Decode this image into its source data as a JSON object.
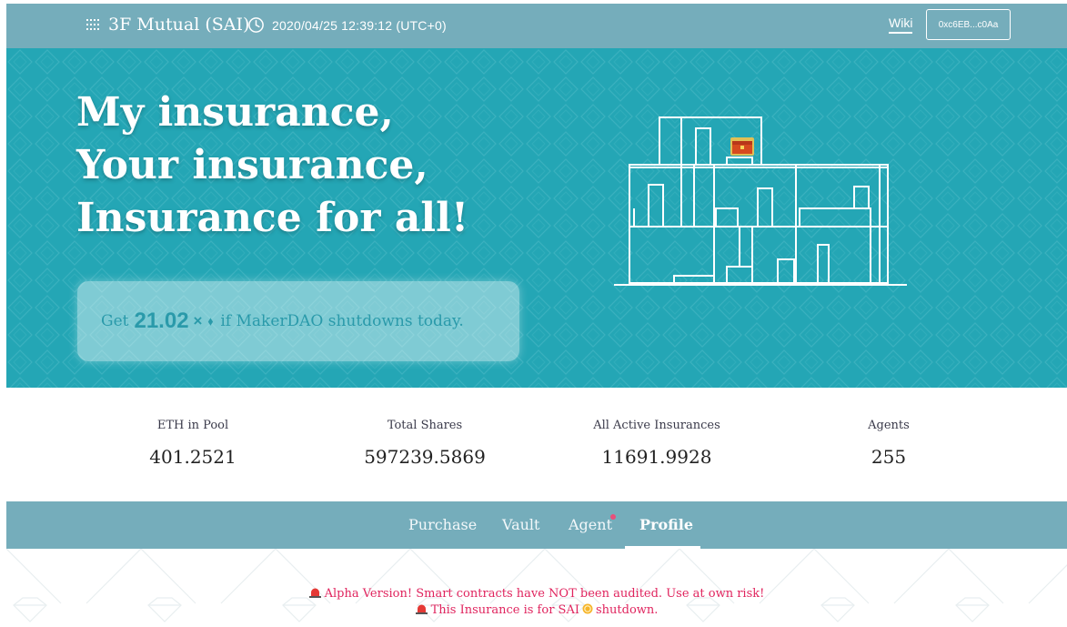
{
  "header": {
    "brand_icon": "grid-dots-icon",
    "title": "3F Mutual (SAI)",
    "clock_icon": "clock-icon",
    "datetime": "2020/04/25 12:39:12 (UTC+0)",
    "wiki_label": "Wiki",
    "wallet_address": "0xc6EB...c0Aa"
  },
  "hero": {
    "slogan": [
      "My insurance,",
      "Your insurance,",
      "Insurance for all!"
    ],
    "payout": {
      "prefix": "Get",
      "multiplier": "21.02",
      "times": "×",
      "eth_symbol": "⬧",
      "suffix": "if MakerDAO shutdowns today."
    },
    "illustration": "house-with-treasure-chest"
  },
  "stats": [
    {
      "label": "ETH in Pool",
      "value": "401.2521"
    },
    {
      "label": "Total Shares",
      "value": "597239.5869"
    },
    {
      "label": "All Active Insurances",
      "value": "11691.9928"
    },
    {
      "label": "Agents",
      "value": "255"
    }
  ],
  "nav": {
    "tabs": [
      {
        "label": "Purchase"
      },
      {
        "label": "Vault"
      },
      {
        "label": "Agent"
      },
      {
        "label": "Profile"
      }
    ],
    "active": "Profile"
  },
  "notices": {
    "alpha": "Alpha Version! Smart contracts have NOT been audited. Use at own risk!",
    "sai_prefix": "This Insurance is for SAI",
    "sai_suffix": "shutdown."
  },
  "colors": {
    "topbar": "#75adbb",
    "hero": "#24a6b5",
    "alert_text": "#e0245e",
    "notification_dot": "#e94f7a"
  }
}
